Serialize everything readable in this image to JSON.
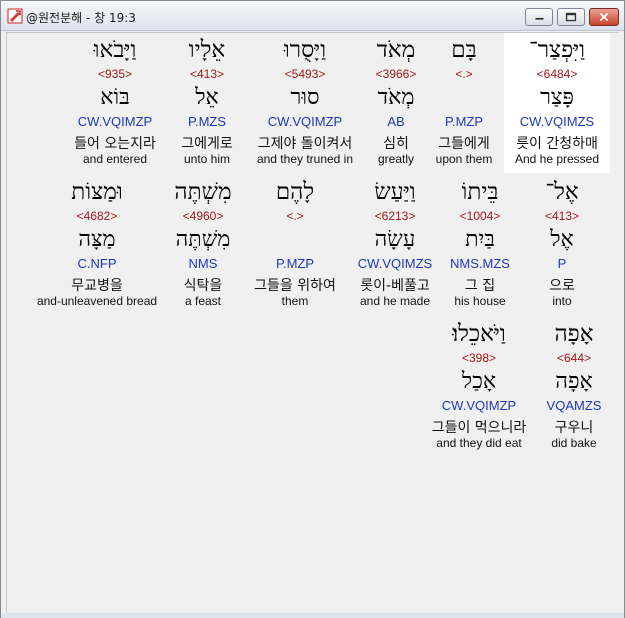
{
  "window": {
    "title": "@원전분해 - 창 19:3"
  },
  "rows": [
    {
      "words": [
        {
          "hebrew": "וַיִּפְצַר־",
          "strong": "<6484>",
          "lemma": "פָּצַר",
          "parse": "CW.VQIMZS",
          "korean": "릇이 간청하매",
          "english": "And he pressed",
          "highlight": true
        },
        {
          "hebrew": "בָּם",
          "strong": "<.>",
          "lemma": "",
          "parse": "P.MZP",
          "korean": "그들에게",
          "english": "upon them",
          "highlight": false
        },
        {
          "hebrew": "מְאֹד",
          "strong": "<3966>",
          "lemma": "מְאֹד",
          "parse": "AB",
          "korean": "심히",
          "english": "greatly",
          "highlight": false
        },
        {
          "hebrew": "וַיָּסֻרוּ",
          "strong": "<5493>",
          "lemma": "סוּר",
          "parse": "CW.VQIMZP",
          "korean": "그제야 돌이켜서",
          "english": "and they truned in",
          "highlight": false
        },
        {
          "hebrew": "אֵלָיו",
          "strong": "<413>",
          "lemma": "אֵל",
          "parse": "P.MZS",
          "korean": "그에게로",
          "english": "unto him",
          "highlight": false
        },
        {
          "hebrew": "וַיָּבֹאוּ",
          "strong": "<935>",
          "lemma": "בּוֹא",
          "parse": "CW.VQIMZP",
          "korean": "들어 오는지라",
          "english": "and entered",
          "highlight": false
        }
      ]
    },
    {
      "words": [
        {
          "hebrew": "אֶל־",
          "strong": "<413>",
          "lemma": "אֶל",
          "parse": "P",
          "korean": "으로",
          "english": "into",
          "highlight": false
        },
        {
          "hebrew": "בֵּיתוֹ",
          "strong": "<1004>",
          "lemma": "בַּיִת",
          "parse": "NMS.MZS",
          "korean": "그 집",
          "english": "his house",
          "highlight": false
        },
        {
          "hebrew": "וַיַּעַשׂ",
          "strong": "<6213>",
          "lemma": "עָשָׂה",
          "parse": "CW.VQIMZS",
          "korean": "롯이-베풀고",
          "english": "and he made",
          "highlight": false
        },
        {
          "hebrew": "לָהֶם",
          "strong": "<.>",
          "lemma": "",
          "parse": "P.MZP",
          "korean": "그들을 위하여",
          "english": "them",
          "highlight": false
        },
        {
          "hebrew": "מִשְׁתֶּה",
          "strong": "<4960>",
          "lemma": "מִשְׁתֶּה",
          "parse": "NMS",
          "korean": "식탁을",
          "english": "a feast",
          "highlight": false
        },
        {
          "hebrew": "וּמַצּוֹת",
          "strong": "<4682>",
          "lemma": "מַצָּה",
          "parse": "C.NFP",
          "korean": "무교병을",
          "english": "and-unleavened bread",
          "highlight": false
        }
      ]
    },
    {
      "words": [
        {
          "hebrew": "אָפָה",
          "strong": "<644>",
          "lemma": "אָפָה",
          "parse": "VQAMZS",
          "korean": "구우니",
          "english": "did bake",
          "highlight": false
        },
        {
          "hebrew": "וַיֹּאכֵלוּ׃",
          "strong": "<398>",
          "lemma": "אָכַל",
          "parse": "CW.VQIMZP",
          "korean": "그들이 먹으니라",
          "english": "and they did eat",
          "highlight": false
        }
      ]
    }
  ]
}
